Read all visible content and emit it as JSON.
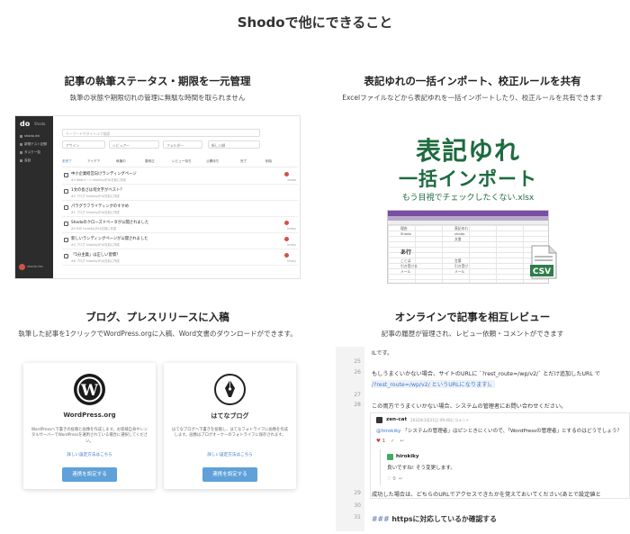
{
  "page": {
    "title": "Shodoで他にできること"
  },
  "features": [
    {
      "title": "記事の執筆ステータス・期限を一元管理",
      "subtitle": "執筆の状態や期限切れの管理に無駄な時間を取られません"
    },
    {
      "title": "表記ゆれの一括インポート、校正ルールを共有",
      "subtitle": "Excelファイルなどから表記ゆれを一括インポートしたり、校正ルールを共有できます"
    },
    {
      "title": "ブログ、プレスリリースに入稿",
      "subtitle": "執筆した記事を1クリックでWordPress.orgに入稿、Word文書のダウンロードができます。"
    },
    {
      "title": "オンラインで記事を相互レビュー",
      "subtitle": "記事の履歴が管理され、レビュー依頼・コメントができます"
    }
  ],
  "app": {
    "logo": "do",
    "logo_text": "Shodo",
    "nav": [
      "shodo.ink",
      "新規テスト記録",
      "タスク一覧",
      "会話"
    ],
    "user": "shodo-tks",
    "search_placeholder": "キーワードやタイトルで検索",
    "filters": [
      "アサイン",
      "レビュアー",
      "フォルダー",
      "新しい順"
    ],
    "tabs": [
      "未完了",
      "アイデア",
      "執筆中",
      "要修正",
      "レビュー待ち",
      "公開待ち",
      "完了",
      "削除"
    ],
    "rows": [
      {
        "title": "中小企業経営向けランディングページ",
        "meta": "#3 Webページ hirokikyが10日前に作成",
        "user": "shodo"
      },
      {
        "title": "1文の長さは何文字がベスト？",
        "meta": "#2 ブログ hirokikyが10日前に作成",
        "user": ""
      },
      {
        "title": "パラグラフライティングのすすめ",
        "meta": "#1 ブログ hirokikyが10日前に作成",
        "user": ""
      },
      {
        "title": "Shodoのクローズドベータが公開されました",
        "meta": "#5 EVE hirokikyが10日前に作成",
        "user": "hiroky"
      },
      {
        "title": "新しいランディングページが公開されました",
        "meta": "#4 ブログ hirokikyが10日前に作成",
        "user": "hiroky"
      },
      {
        "title": "「5分主義」は正しい習慣？",
        "meta": "#6 ブログ hirokikyが10日前に作成",
        "user": "hiroky"
      }
    ]
  },
  "import": {
    "line1": "表記ゆれ",
    "line2": "一括インポート",
    "line3": "もう目視でチェックしたくない.xlsx",
    "sheet_header": "あ行",
    "csv_label": "CSV",
    "cells": [
      "理由",
      "表記ゆれ",
      "Shodo",
      "shodo",
      "文書",
      "文書",
      "ことば",
      "言葉",
      "引き受ける",
      "引き受け",
      "メール",
      "メール"
    ]
  },
  "publish": [
    {
      "name": "WordPress.org",
      "desc": "WordPressへ下書きの投稿と画像を作成します。お客様自身やレンタルサーバーでWordPressを運用されている場合に選択してください。",
      "link": "詳しい設定方法はこちら",
      "button": "連携を設定する"
    },
    {
      "name": "はてなブログ",
      "desc": "はてなブログへ下書きを投稿し、はてなフォトライフに画像を作成します。画像はブログオーナーのフォトライフに保存されます。",
      "link": "詳しい設定方法はこちら",
      "button": "連携を設定する"
    }
  ],
  "review": {
    "lines": [
      {
        "n": "",
        "t": "ILです。"
      },
      {
        "n": "25",
        "t": ""
      },
      {
        "n": "26",
        "t": "もしうまくいかない場合、サイトのURLに `?rest_route=/wp/v2/` とだけ追加したURL で"
      },
      {
        "n": "",
        "t": "/?rest_route=/wp/v2/ というURLになります)。"
      },
      {
        "n": "27",
        "t": ""
      },
      {
        "n": "28",
        "t": "この両方でうまくいかない場合、システムの管理者にお問い合わせください。"
      },
      {
        "n": "29",
        "t": "成功した場合は、どちらのURLでアクセスできたかを覚えておいてください(あとで設定値と"
      },
      {
        "n": "30",
        "t": ""
      },
      {
        "n": "31",
        "t": ""
      }
    ],
    "comment1": {
      "user": "zen-cat",
      "date": "2022年3月21日 09:40にコメント",
      "mention": "@hirokiky",
      "text": "「システムの管理者」はピンときにくいので、「WordPressの管理者」とするのはどうでしょう？",
      "likes": "1"
    },
    "comment2": {
      "user": "hirokiky",
      "text": "良いですね! そう変更します。",
      "likes": "0"
    },
    "heading_marker": "###",
    "heading": "httpsに対応しているか確認する"
  }
}
